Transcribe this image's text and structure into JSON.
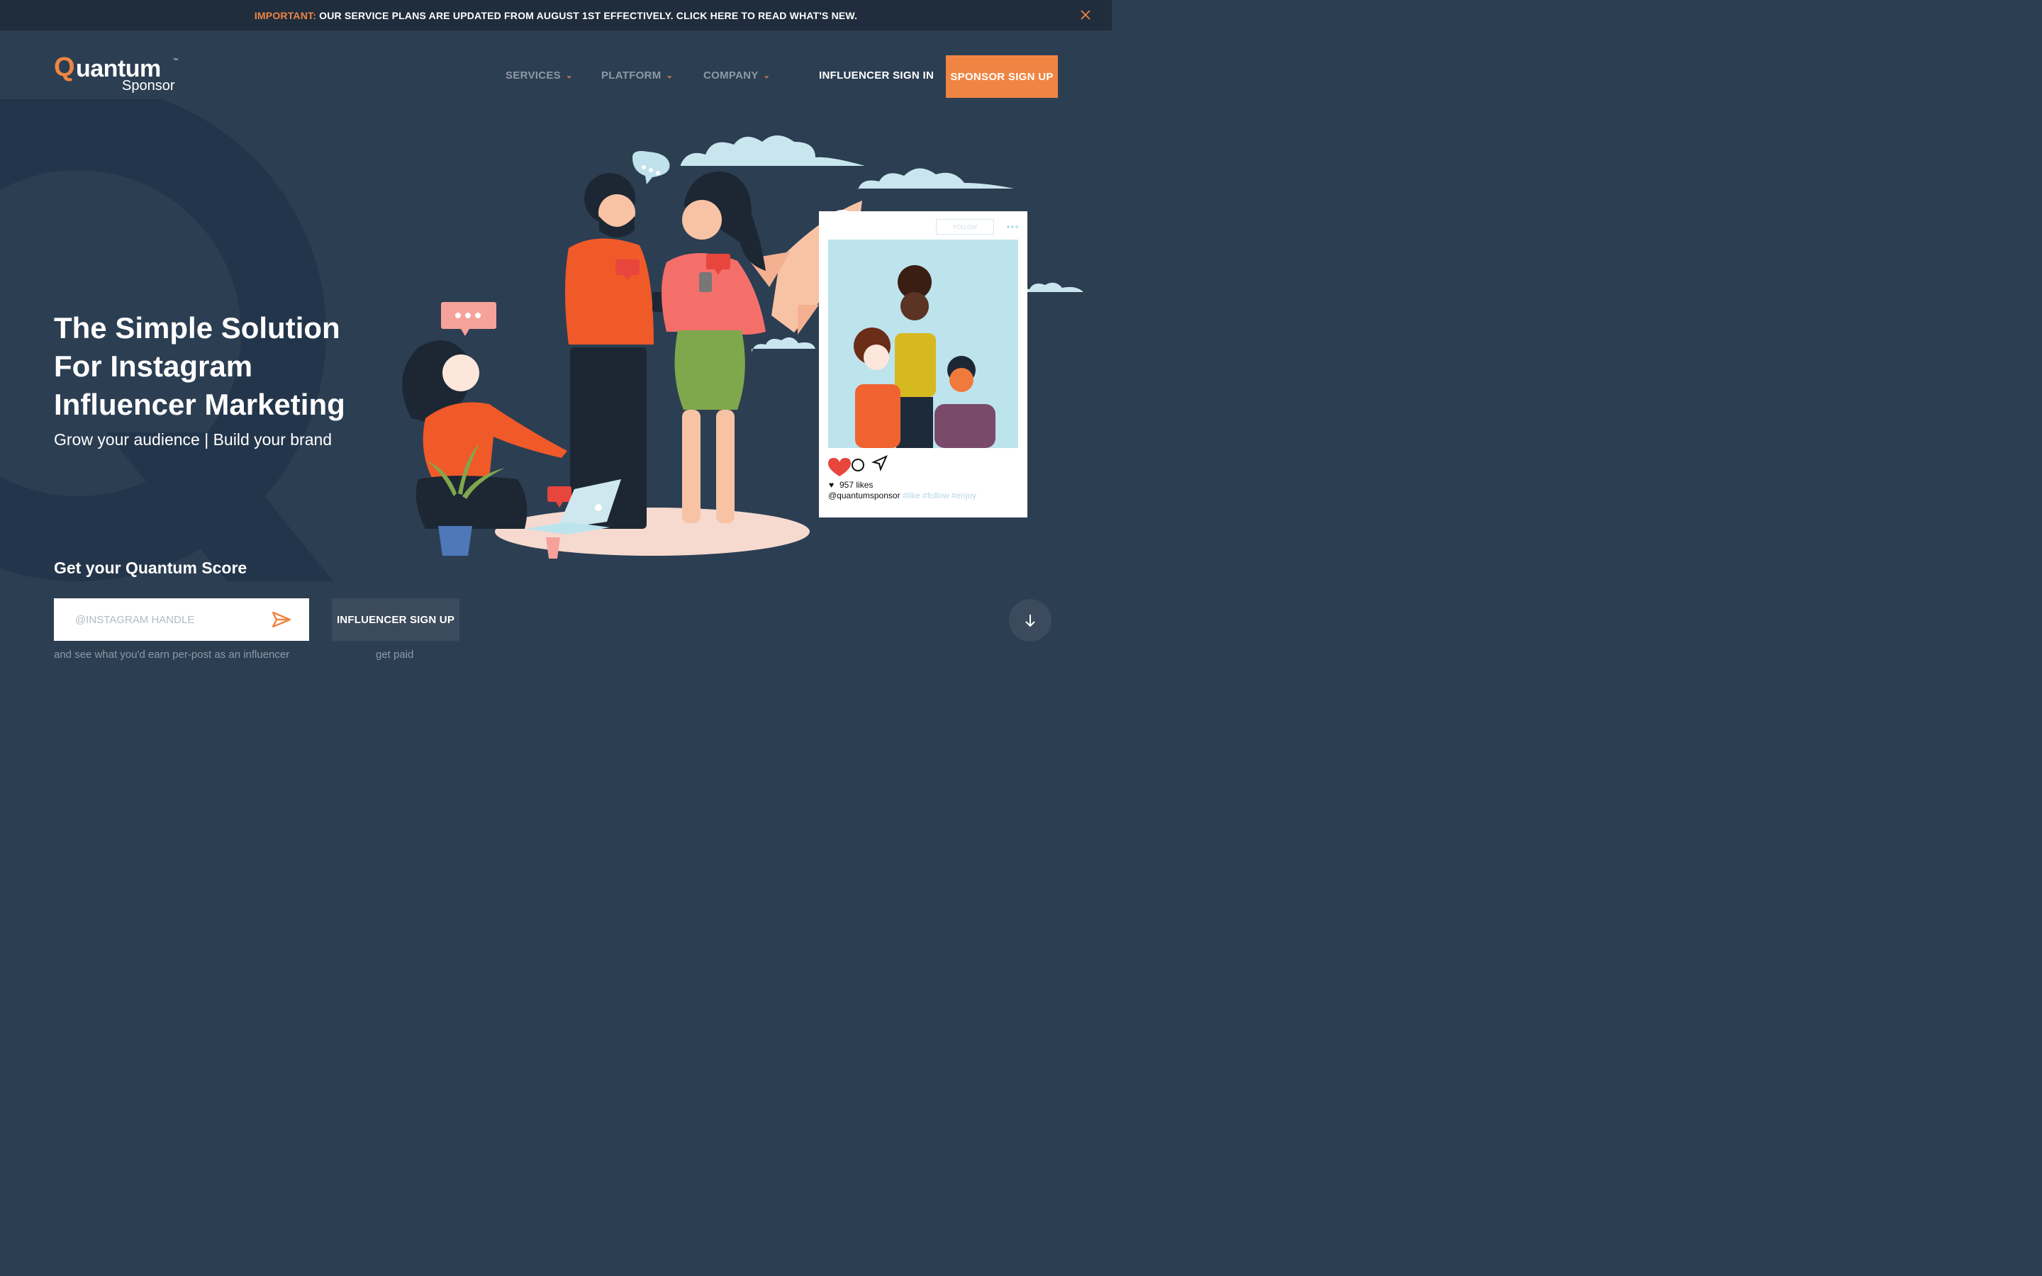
{
  "announcement": {
    "label": "IMPORTANT:",
    "message": "OUR SERVICE PLANS ARE UPDATED FROM AUGUST 1ST EFFECTIVELY. CLICK HERE TO READ WHAT'S NEW."
  },
  "logo": {
    "q": "Q",
    "rest": "uantum",
    "tm": "™",
    "sub": "Sponsor"
  },
  "nav": {
    "items": [
      {
        "label": "SERVICES"
      },
      {
        "label": "PLATFORM"
      },
      {
        "label": "COMPANY"
      }
    ],
    "signin": "INFLUENCER SIGN IN",
    "cta": "SPONSOR SIGN UP"
  },
  "hero": {
    "line1": "The Simple Solution",
    "line2": "For Instagram",
    "line3": "Influencer Marketing",
    "subtitle": "Grow your audience | Build your brand"
  },
  "instagram_card": {
    "follow": "FOLLOW",
    "likes": "957 likes",
    "user": "@quantumsponsor",
    "tags": "#like #follow #enjoy"
  },
  "score": {
    "title": "Get your Quantum Score",
    "placeholder": "@INSTAGRAM HANDLE",
    "caption": "and see what you'd earn per-post as an influencer",
    "signup_label": "INFLUENCER SIGN UP",
    "signup_caption": "get paid"
  },
  "colors": {
    "accent": "#f08543",
    "background": "#2c3e52",
    "topbar": "#1f2d3d"
  }
}
